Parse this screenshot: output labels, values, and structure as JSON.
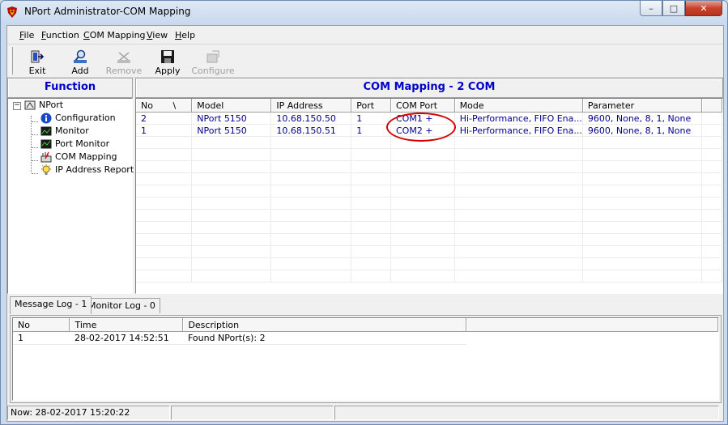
{
  "window": {
    "title": "NPort Administrator-COM Mapping",
    "minimize_glyph": "–",
    "maximize_glyph": "□",
    "close_glyph": "✕"
  },
  "menu": {
    "file": {
      "key": "F",
      "rest": "ile"
    },
    "function": {
      "key": "F",
      "rest": "unction"
    },
    "com_mapping": {
      "key": "C",
      "rest": "OM Mapping"
    },
    "view": {
      "key": "V",
      "rest": "iew"
    },
    "help": {
      "key": "H",
      "rest": "elp"
    }
  },
  "toolbar": {
    "exit": "Exit",
    "add": "Add",
    "remove": "Remove",
    "apply": "Apply",
    "configure": "Configure"
  },
  "function_panel": {
    "header": "Function",
    "tree_root": "NPort",
    "items": [
      "Configuration",
      "Monitor",
      "Port Monitor",
      "COM Mapping",
      "IP Address Report"
    ],
    "expander_glyph": "−"
  },
  "main_panel": {
    "header": "COM Mapping - 2 COM",
    "sort_indicator": "\\",
    "columns": [
      "No",
      "Model",
      "IP Address",
      "Port",
      "COM Port",
      "Mode",
      "Parameter"
    ],
    "rows": [
      [
        "2",
        "NPort 5150",
        "10.68.150.50",
        "1",
        "COM1 +",
        "Hi-Performance, FIFO Ena...",
        "9600, None, 8, 1, None"
      ],
      [
        "1",
        "NPort 5150",
        "10.68.150.51",
        "1",
        "COM2 +",
        "Hi-Performance, FIFO Ena...",
        "9600, None, 8, 1, None"
      ]
    ],
    "annotation_color": "#d40000"
  },
  "log_tabs": [
    "Message Log - 1",
    "Monitor Log - 0"
  ],
  "message_log": {
    "columns": [
      "No",
      "Time",
      "Description"
    ],
    "rows": [
      [
        "1",
        "28-02-2017 14:52:51",
        "Found NPort(s): 2"
      ]
    ]
  },
  "statusbar": {
    "now": "Now: 28-02-2017 15:20:22"
  },
  "colors": {
    "header_text": "#0000c8",
    "row_text": "#00008b"
  }
}
